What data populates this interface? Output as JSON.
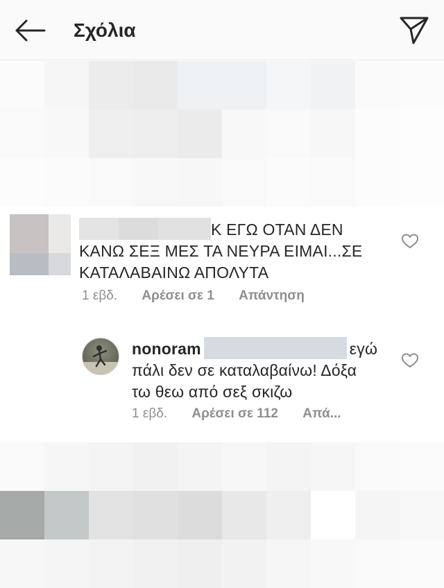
{
  "header": {
    "title": "Σχόλια",
    "back_icon": "arrow-left-icon",
    "send_icon": "paper-plane-icon"
  },
  "comments": [
    {
      "avatar_type": "blurred",
      "text_redacted": true,
      "text_lines": [
        "Κ ΕΓΩ ΟΤΑΝ ΔΕΝ",
        "ΚΑΝΩ ΣΕΞ ΜΕΣ ΤΑ ΝΕΥΡΑ ΕΙΜΑΙ...ΣΕ",
        "ΚΑΤΑΛΑΒΑΙΝΩ ΑΠΟΛΥΤΑ"
      ],
      "time": "1 εβδ.",
      "likes_label": "Αρέσει σε 1",
      "reply_label": "Απάντηση",
      "heart_icon": "heart-outline-icon"
    }
  ],
  "replies": [
    {
      "username": "nonoram",
      "text_redacted": true,
      "text_lines": [
        "εγώ",
        "πάλι δεν σε καταλαβαίνω! Δόξα",
        "τω θεω από σεξ σκιζω"
      ],
      "time": "1 εβδ.",
      "likes_label": "Αρέσει σε 112",
      "reply_label": "Απά...",
      "heart_icon": "heart-outline-icon"
    }
  ],
  "colors": {
    "text": "#262626",
    "meta": "#8e8e8e",
    "header_bg": "#fafafa"
  }
}
